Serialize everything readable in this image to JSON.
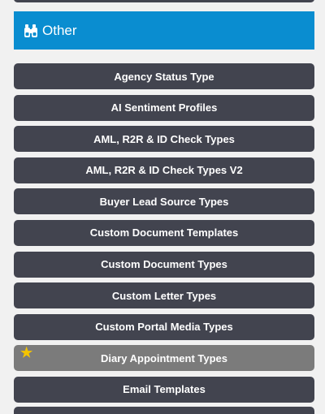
{
  "section": {
    "title": "Other",
    "icon": "binoculars-icon",
    "color": "#0a8dd0"
  },
  "menu": {
    "items": [
      {
        "label": "Agency Status Type"
      },
      {
        "label": "AI Sentiment Profiles"
      },
      {
        "label": "AML, R2R & ID Check Types"
      },
      {
        "label": "AML, R2R & ID Check Types V2"
      },
      {
        "label": "Buyer Lead Source Types"
      },
      {
        "label": "Custom Document Templates"
      },
      {
        "label": "Custom Document Types"
      },
      {
        "label": "Custom Letter Types"
      },
      {
        "label": "Custom Portal Media Types"
      },
      {
        "label": "Diary Appointment Types",
        "starred": true,
        "active": true
      },
      {
        "label": "Email Templates"
      }
    ]
  },
  "colors": {
    "item_background": "#42444f",
    "active_item_background": "#7b7b7b",
    "star": "#f5c400"
  }
}
